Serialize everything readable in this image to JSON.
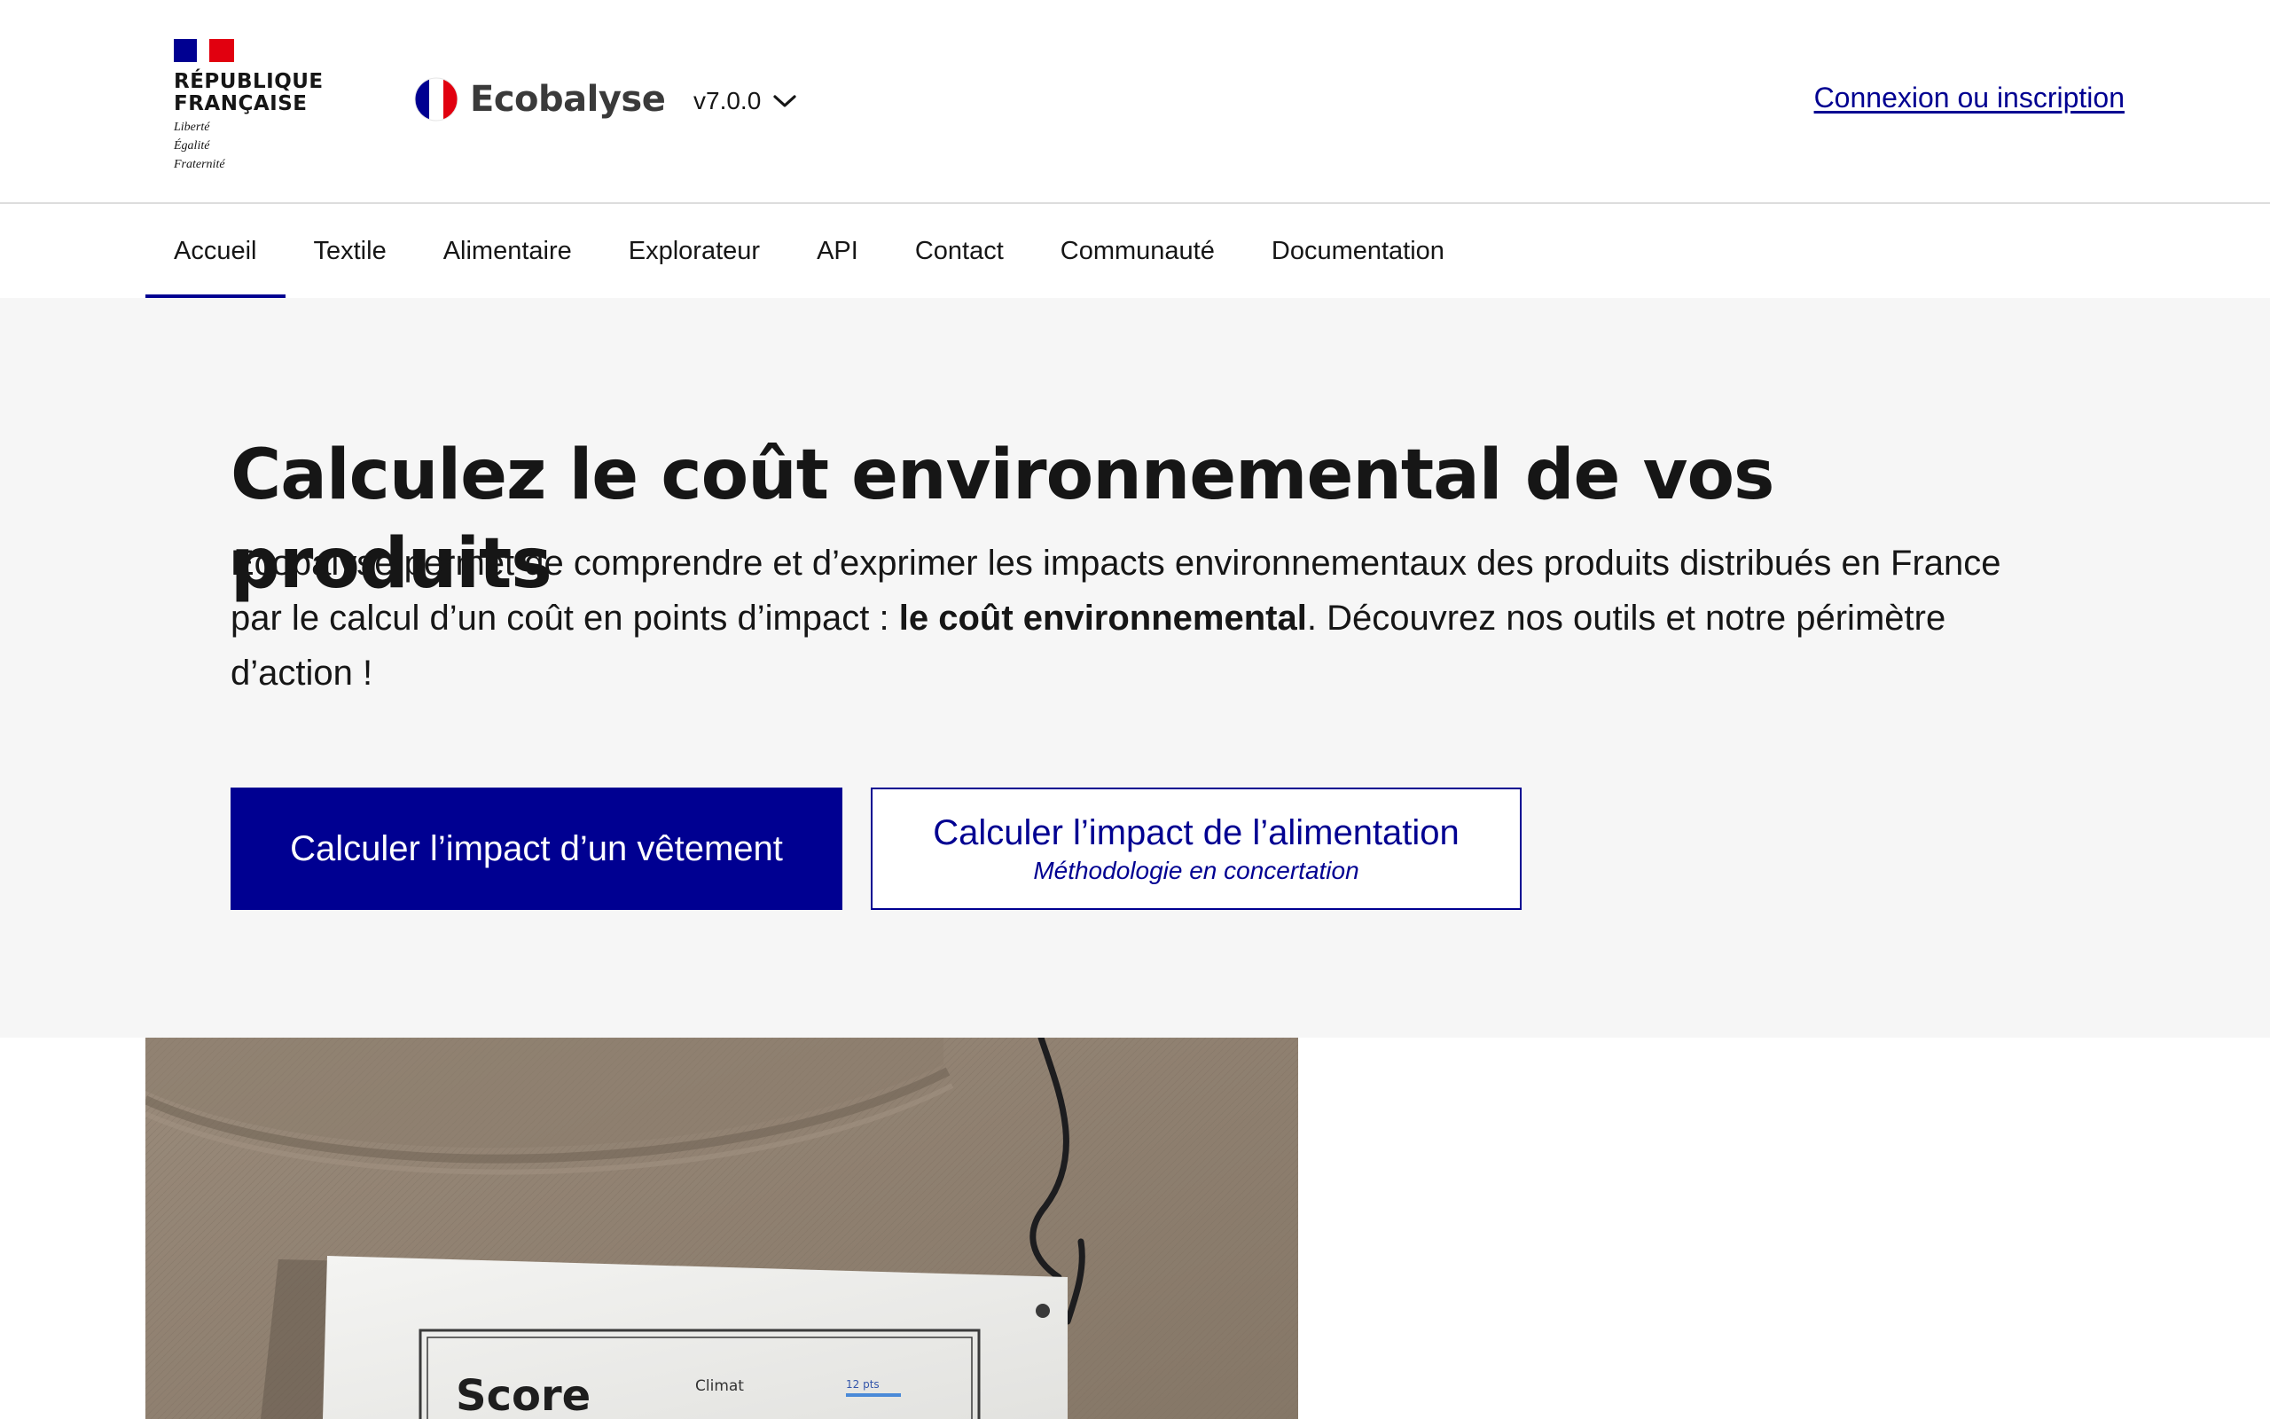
{
  "header": {
    "republique_line1": "République",
    "republique_line2": "Française",
    "motto_1": "Liberté",
    "motto_2": "Égalité",
    "motto_3": "Fraternité",
    "service_name": "Ecobalyse",
    "version": "v7.0.0",
    "login": "Connexion ou inscription"
  },
  "nav": {
    "items": [
      {
        "label": "Accueil",
        "active": true
      },
      {
        "label": "Textile"
      },
      {
        "label": "Alimentaire"
      },
      {
        "label": "Explorateur"
      },
      {
        "label": "API"
      },
      {
        "label": "Contact"
      },
      {
        "label": "Communauté"
      },
      {
        "label": "Documentation"
      }
    ]
  },
  "hero": {
    "title": "Calculez le coût environnemental de vos produits",
    "text_before": "Ecobalyse permet de comprendre et d’exprimer les impacts environnementaux des produits distribués en France par le calcul d’un coût en points d’impact : ",
    "text_bold": "le coût environnemental",
    "text_after": ". Découvrez nos outils et notre périmètre d’action !",
    "btn_primary": "Calculer l’impact d’un vêtement",
    "btn_secondary": "Calculer l’impact de l’alimentation",
    "btn_secondary_sub": "Méthodologie en concertation"
  },
  "photo": {
    "tag_title": "Score",
    "tag_row_label": "Climat",
    "tag_row_value": "12 pts"
  },
  "colors": {
    "brand_blue": "#000091",
    "brand_red": "#e1000f",
    "hero_bg": "#f6f6f6"
  }
}
